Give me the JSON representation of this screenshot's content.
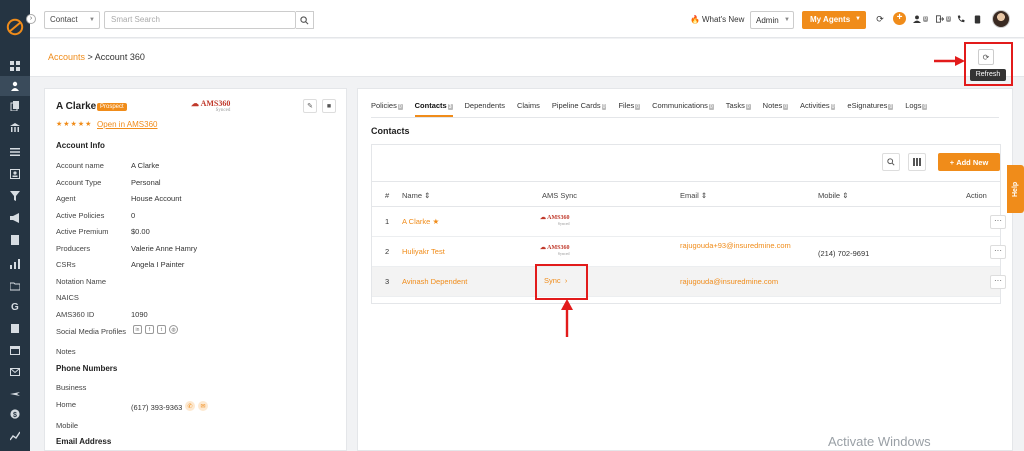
{
  "topbar": {
    "search_type": "Contact",
    "search_placeholder": "Smart Search",
    "whats_new": "What's New",
    "role": "Admin",
    "agents_button": "My Agents",
    "badge_a": "0",
    "badge_b": "0"
  },
  "breadcrumb": {
    "root": "Accounts",
    "separator": " > ",
    "current": "Account 360"
  },
  "refresh_tooltip": "Refresh",
  "account": {
    "name": "A Clarke",
    "status": "Prospect",
    "ams_logo": "AMS360",
    "ams_sub": "Synced",
    "open_link": "Open in AMS360",
    "section_info": "Account Info",
    "fields": [
      {
        "label": "Account name",
        "value": "A Clarke"
      },
      {
        "label": "Account Type",
        "value": "Personal"
      },
      {
        "label": "Agent",
        "value": "House Account"
      },
      {
        "label": "Active Policies",
        "value": "0"
      },
      {
        "label": "Active Premium",
        "value": "$0.00"
      },
      {
        "label": "Producers",
        "value": "Valerie Anne Hamry"
      },
      {
        "label": "CSRs",
        "value": "Angela I Painter"
      },
      {
        "label": "Notation Name",
        "value": ""
      },
      {
        "label": "NAICS",
        "value": ""
      },
      {
        "label": "AMS360 ID",
        "value": "1090"
      },
      {
        "label": "Social Media Profiles",
        "value": ""
      },
      {
        "label": "Notes",
        "value": ""
      }
    ],
    "section_phone": "Phone Numbers",
    "phone_fields": [
      {
        "label": "Business",
        "value": ""
      },
      {
        "label": "Home",
        "value": "(617) 393-9363"
      },
      {
        "label": "Mobile",
        "value": ""
      }
    ],
    "section_email": "Email Address"
  },
  "tabs": [
    {
      "label": "Policies",
      "count": "0"
    },
    {
      "label": "Contacts",
      "count": "3",
      "active": true
    },
    {
      "label": "Dependents",
      "count": ""
    },
    {
      "label": "Claims",
      "count": ""
    },
    {
      "label": "Pipeline Cards",
      "count": "0"
    },
    {
      "label": "Files",
      "count": "0"
    },
    {
      "label": "Communications",
      "count": "0"
    },
    {
      "label": "Tasks",
      "count": "0"
    },
    {
      "label": "Notes",
      "count": "0"
    },
    {
      "label": "Activities",
      "count": "0"
    },
    {
      "label": "eSignatures",
      "count": "0"
    },
    {
      "label": "Logs",
      "count": "0"
    }
  ],
  "contacts": {
    "title": "Contacts",
    "add_new": "Add New",
    "columns": {
      "num": "#",
      "name": "Name",
      "ams": "AMS Sync",
      "email": "Email",
      "mobile": "Mobile",
      "action": "Action"
    },
    "rows": [
      {
        "num": "1",
        "name": "A Clarke",
        "ams": "AMS360",
        "email": "",
        "mobile": ""
      },
      {
        "num": "2",
        "name": "Huliyakr Test",
        "ams": "AMS360",
        "email": "rajugouda+93@insuredmine.com",
        "mobile": "(214) 702-9691"
      },
      {
        "num": "3",
        "name": "Avinash Dependent",
        "ams": "Sync",
        "email": "rajugouda@insuredmine.com",
        "mobile": ""
      }
    ]
  },
  "help_label": "Help",
  "watermark": "Activate Windows",
  "colors": {
    "accent": "#f08c1a",
    "rail": "#253442",
    "annotation": "#e21b1b"
  }
}
